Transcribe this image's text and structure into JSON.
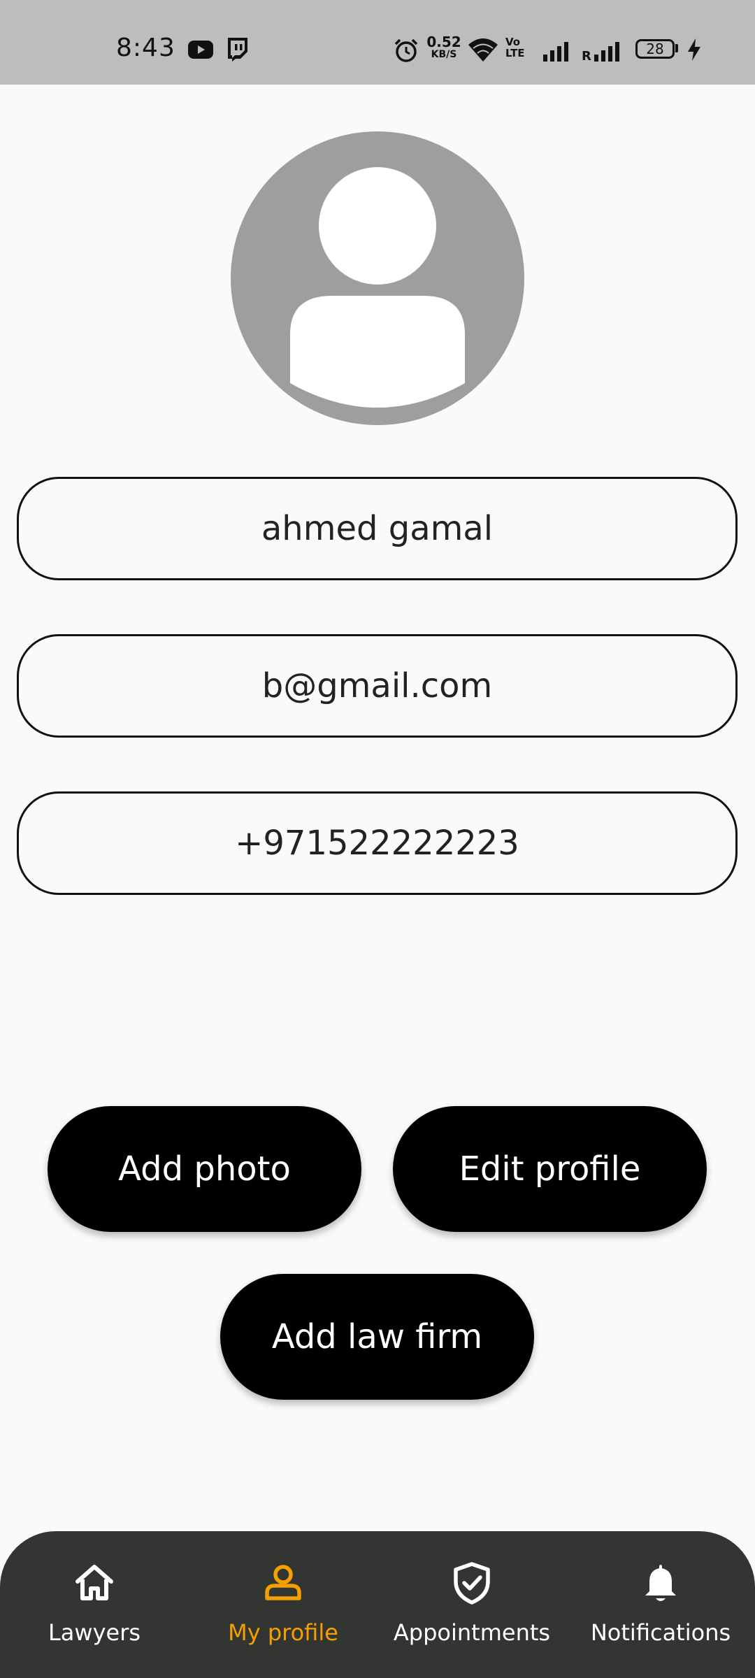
{
  "status_bar": {
    "time": "8:43",
    "net_speed": "0.52",
    "net_speed_unit": "KB/S",
    "volte": "Vo LTE",
    "roaming": "R",
    "battery": "28"
  },
  "profile": {
    "name": "ahmed gamal",
    "email": "b@gmail.com",
    "phone": "+971522222223"
  },
  "actions": {
    "add_photo": "Add photo",
    "edit_profile": "Edit profile",
    "add_law_firm": "Add law firm"
  },
  "bottom_nav": {
    "items": [
      {
        "label": "Lawyers",
        "icon": "home-icon"
      },
      {
        "label": "My profile",
        "icon": "person-icon"
      },
      {
        "label": "Appointments",
        "icon": "shield-check-icon"
      },
      {
        "label": "Notifications",
        "icon": "bell-icon"
      }
    ],
    "active_color": "#f5a000",
    "background": "#333533"
  }
}
